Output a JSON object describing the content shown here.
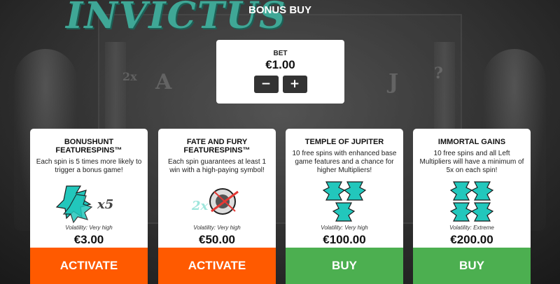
{
  "game": {
    "logo_text": "INVICTUS"
  },
  "header": {
    "title": "BONUS BUY"
  },
  "bet": {
    "label": "BET",
    "value": "€1.00",
    "minus": "−",
    "plus": "+"
  },
  "cards": [
    {
      "title_line1": "BONUSHUNT",
      "title_line2": "FEATURESPINS™",
      "description": "Each spin is 5 times more likely to trigger a bonus game!",
      "image_text": "x5",
      "volatility": "Volatility: Very high",
      "price": "€3.00",
      "action": "ACTIVATE",
      "action_color": "#ff5a00"
    },
    {
      "title_line1": "FATE AND FURY",
      "title_line2": "FEATURESPINS™",
      "description": "Each spin guarantees at least 1 win with a high-paying symbol!",
      "image_text": "2x",
      "volatility": "Volatility: Very high",
      "price": "€50.00",
      "action": "ACTIVATE",
      "action_color": "#ff5a00"
    },
    {
      "title_line1": "TEMPLE OF JUPITER",
      "title_line2": "",
      "description": "10 free spins with enhanced base game features and a chance for higher Multipliers!",
      "volatility": "Volatility: Very high",
      "price": "€100.00",
      "action": "BUY",
      "action_color": "#4caf50"
    },
    {
      "title_line1": "IMMORTAL GAINS",
      "title_line2": "",
      "description": "10 free spins and all Left Multipliers will have a minimum of 5x on each spin!",
      "volatility": "Volatility: Extreme",
      "price": "€200.00",
      "action": "BUY",
      "action_color": "#4caf50"
    }
  ],
  "colors": {
    "activate": "#ff5a00",
    "buy": "#4caf50",
    "symbol": "#22c7bc",
    "logo": "#3fa796"
  }
}
